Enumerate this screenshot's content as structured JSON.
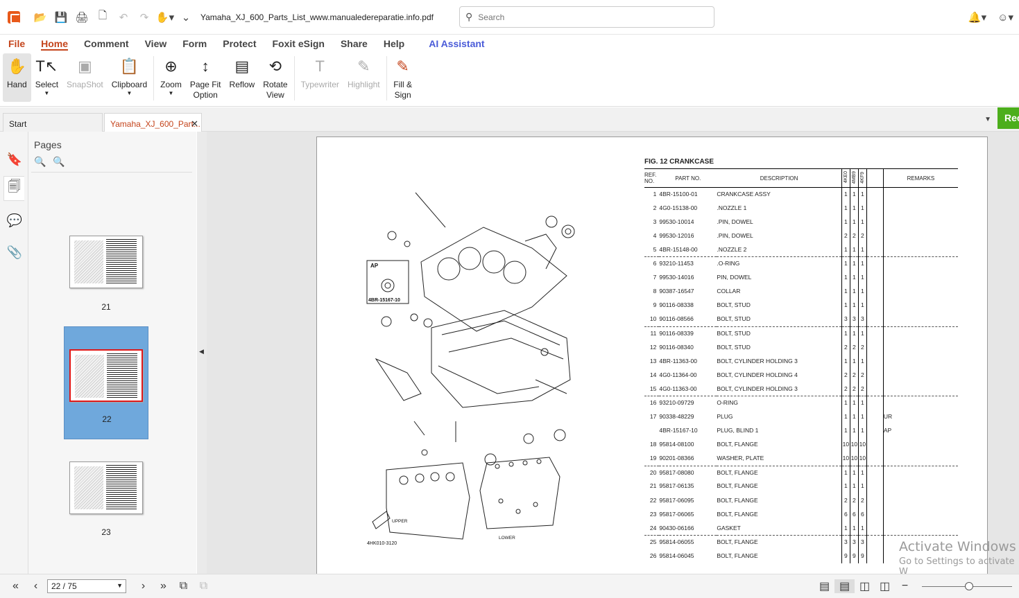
{
  "titlebar": {
    "doc_title": "Yamaha_XJ_600_Parts_List_www.manualedereparatie.info.pdf (S...",
    "search_placeholder": "Search"
  },
  "menu": [
    "File",
    "Home",
    "Comment",
    "View",
    "Form",
    "Protect",
    "Foxit eSign",
    "Share",
    "Help"
  ],
  "menu_ai": "AI Assistant",
  "ribbon": {
    "hand": "Hand",
    "select": "Select",
    "snapshot": "SnapShot",
    "clipboard": "Clipboard",
    "zoom": "Zoom",
    "pagefit": "Page Fit\nOption",
    "reflow": "Reflow",
    "rotate": "Rotate\nView",
    "typewriter": "Typewriter",
    "highlight": "Highlight",
    "fillsign": "Fill &\nSign"
  },
  "tabs": {
    "start": "Start",
    "doc": "Yamaha_XJ_600_Part...",
    "rec_label": "Rec"
  },
  "pages_panel": {
    "title": "Pages",
    "thumbs": [
      {
        "num": "21"
      },
      {
        "num": "22"
      },
      {
        "num": "23"
      }
    ]
  },
  "document": {
    "fig_title": "FIG.  12   CRANKCASE",
    "headers": {
      "ref": "REF.\nNO.",
      "part": "PART NO.",
      "desc": "DESCRIPTION",
      "m1": "4KE0",
      "m2": "4MB9",
      "m3": "4KF9",
      "remarks": "REMARKS"
    },
    "drawing_code": "4HK010-3120",
    "labels": {
      "ap": "AP",
      "ap_part": "4BR-15167-10",
      "upper": "UPPER",
      "lower": "LOWER",
      "fwd": "FWD"
    },
    "rows": [
      {
        "ref": "1",
        "part": "4BR-15100-01",
        "desc": "CRANKCASE ASSY",
        "q": [
          "1",
          "1",
          "1"
        ],
        "rem": ""
      },
      {
        "ref": "2",
        "part": "4G0-15138-00",
        "desc": ".NOZZLE 1",
        "q": [
          "1",
          "1",
          "1"
        ],
        "rem": ""
      },
      {
        "ref": "3",
        "part": "99530-10014",
        "desc": ".PIN, DOWEL",
        "q": [
          "1",
          "1",
          "1"
        ],
        "rem": ""
      },
      {
        "ref": "4",
        "part": "99530-12016",
        "desc": ".PIN, DOWEL",
        "q": [
          "2",
          "2",
          "2"
        ],
        "rem": ""
      },
      {
        "ref": "5",
        "part": "4BR-15148-00",
        "desc": ".NOZZLE 2",
        "q": [
          "1",
          "1",
          "1"
        ],
        "rem": ""
      },
      {
        "ref": "6",
        "part": "93210-11453",
        "desc": ".O-RING",
        "q": [
          "1",
          "1",
          "1"
        ],
        "rem": "",
        "dash": true
      },
      {
        "ref": "7",
        "part": "99530-14016",
        "desc": "PIN, DOWEL",
        "q": [
          "1",
          "1",
          "1"
        ],
        "rem": ""
      },
      {
        "ref": "8",
        "part": "90387-16547",
        "desc": "COLLAR",
        "q": [
          "1",
          "1",
          "1"
        ],
        "rem": ""
      },
      {
        "ref": "9",
        "part": "90116-08338",
        "desc": "BOLT, STUD",
        "q": [
          "1",
          "1",
          "1"
        ],
        "rem": ""
      },
      {
        "ref": "10",
        "part": "90116-08566",
        "desc": "BOLT, STUD",
        "q": [
          "3",
          "3",
          "3"
        ],
        "rem": ""
      },
      {
        "ref": "11",
        "part": "90116-08339",
        "desc": "BOLT, STUD",
        "q": [
          "1",
          "1",
          "1"
        ],
        "rem": "",
        "dash": true
      },
      {
        "ref": "12",
        "part": "90116-08340",
        "desc": "BOLT, STUD",
        "q": [
          "2",
          "2",
          "2"
        ],
        "rem": ""
      },
      {
        "ref": "13",
        "part": "4BR-11363-00",
        "desc": "BOLT, CYLINDER HOLDING 3",
        "q": [
          "1",
          "1",
          "1"
        ],
        "rem": ""
      },
      {
        "ref": "14",
        "part": "4G0-11364-00",
        "desc": "BOLT, CYLINDER HOLDING 4",
        "q": [
          "2",
          "2",
          "2"
        ],
        "rem": ""
      },
      {
        "ref": "15",
        "part": "4G0-11363-00",
        "desc": "BOLT, CYLINDER HOLDING 3",
        "q": [
          "2",
          "2",
          "2"
        ],
        "rem": ""
      },
      {
        "ref": "16",
        "part": "93210-09729",
        "desc": "O-RING",
        "q": [
          "1",
          "1",
          "1"
        ],
        "rem": "",
        "dash": true
      },
      {
        "ref": "17",
        "part": "90338-48229",
        "desc": "PLUG",
        "q": [
          "1",
          "1",
          "1"
        ],
        "rem": "UR"
      },
      {
        "ref": "",
        "part": "4BR-15167-10",
        "desc": "PLUG, BLIND 1",
        "q": [
          "1",
          "1",
          "1"
        ],
        "rem": "AP"
      },
      {
        "ref": "18",
        "part": "95814-08100",
        "desc": "BOLT, FLANGE",
        "q": [
          "10",
          "10",
          "10"
        ],
        "rem": ""
      },
      {
        "ref": "19",
        "part": "90201-08366",
        "desc": "WASHER, PLATE",
        "q": [
          "10",
          "10",
          "10"
        ],
        "rem": ""
      },
      {
        "ref": "20",
        "part": "95817-08080",
        "desc": "BOLT, FLANGE",
        "q": [
          "1",
          "1",
          "1"
        ],
        "rem": "",
        "dash": true
      },
      {
        "ref": "21",
        "part": "95817-06135",
        "desc": "BOLT, FLANGE",
        "q": [
          "1",
          "1",
          "1"
        ],
        "rem": ""
      },
      {
        "ref": "22",
        "part": "95817-06095",
        "desc": "BOLT, FLANGE",
        "q": [
          "2",
          "2",
          "2"
        ],
        "rem": ""
      },
      {
        "ref": "23",
        "part": "95817-06065",
        "desc": "BOLT, FLANGE",
        "q": [
          "6",
          "6",
          "6"
        ],
        "rem": ""
      },
      {
        "ref": "24",
        "part": "90430-06166",
        "desc": "GASKET",
        "q": [
          "1",
          "1",
          "1"
        ],
        "rem": ""
      },
      {
        "ref": "25",
        "part": "95814-06055",
        "desc": "BOLT, FLANGE",
        "q": [
          "3",
          "3",
          "3"
        ],
        "rem": "",
        "dash": true
      },
      {
        "ref": "26",
        "part": "95814-06045",
        "desc": "BOLT, FLANGE",
        "q": [
          "9",
          "9",
          "9"
        ],
        "rem": ""
      }
    ]
  },
  "watermark": {
    "line1": "Activate Windows",
    "line2": "Go to Settings to activate W"
  },
  "status": {
    "page_value": "22 / 75"
  }
}
